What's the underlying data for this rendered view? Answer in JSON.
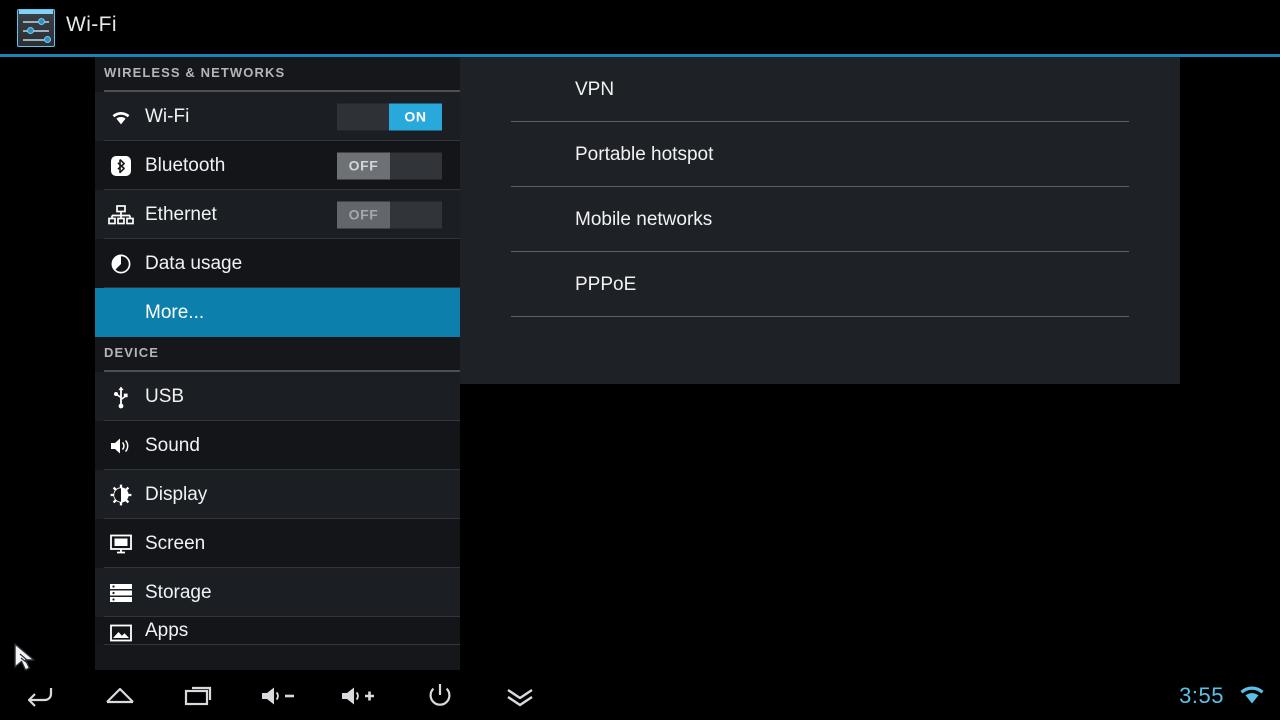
{
  "titlebar": {
    "title": "Wi-Fi",
    "icon": "settings-sliders-icon",
    "accent_color": "#1c84b5"
  },
  "sidebar": {
    "sections": [
      {
        "header": "WIRELESS & NETWORKS",
        "items": [
          {
            "label": "Wi-Fi",
            "icon": "wifi-icon",
            "toggle": "ON",
            "toggle_state": "on"
          },
          {
            "label": "Bluetooth",
            "icon": "bluetooth-icon",
            "toggle": "OFF",
            "toggle_state": "off"
          },
          {
            "label": "Ethernet",
            "icon": "ethernet-icon",
            "toggle": "OFF",
            "toggle_state": "off-disabled"
          },
          {
            "label": "Data usage",
            "icon": "data-usage-icon",
            "toggle": null
          },
          {
            "label": "More...",
            "icon": null,
            "toggle": null,
            "selected": true
          }
        ]
      },
      {
        "header": "DEVICE",
        "items": [
          {
            "label": "USB",
            "icon": "usb-icon",
            "toggle": null
          },
          {
            "label": "Sound",
            "icon": "sound-icon",
            "toggle": null
          },
          {
            "label": "Display",
            "icon": "display-icon",
            "toggle": null
          },
          {
            "label": "Screen",
            "icon": "screen-icon",
            "toggle": null
          },
          {
            "label": "Storage",
            "icon": "storage-icon",
            "toggle": null
          },
          {
            "label": "Apps",
            "icon": "apps-icon",
            "toggle": null,
            "clipped": true
          }
        ]
      }
    ],
    "selected_color": "#0d7fad",
    "toggle_on_color": "#29a8dc"
  },
  "panel": {
    "items": [
      {
        "label": "VPN"
      },
      {
        "label": "Portable hotspot"
      },
      {
        "label": "Mobile networks"
      },
      {
        "label": "PPPoE"
      }
    ]
  },
  "navbar": {
    "buttons": [
      {
        "name": "back-icon"
      },
      {
        "name": "home-icon"
      },
      {
        "name": "recents-icon"
      },
      {
        "name": "volume-down-icon"
      },
      {
        "name": "volume-up-icon"
      },
      {
        "name": "power-icon"
      },
      {
        "name": "hide-navbar-icon"
      }
    ],
    "clock": "3:55",
    "status_icon": "wifi-signal-icon",
    "status_color": "#5bc0e8"
  },
  "cursor": {
    "type": "arrow-pointer"
  }
}
